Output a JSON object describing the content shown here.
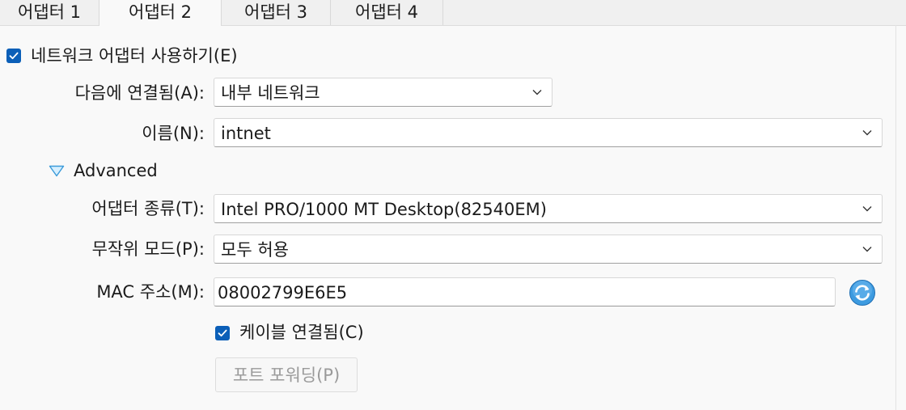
{
  "tabs": [
    {
      "label": "어댑터 1",
      "active": false
    },
    {
      "label": "어댑터 2",
      "active": true
    },
    {
      "label": "어댑터 3",
      "active": false
    },
    {
      "label": "어댑터 4",
      "active": false
    }
  ],
  "enable_adapter": {
    "label": "네트워크 어댑터 사용하기(E)",
    "checked": true
  },
  "attached_to": {
    "label": "다음에 연결됨(A):",
    "value": "내부 네트워크"
  },
  "name": {
    "label": "이름(N):",
    "value": "intnet"
  },
  "advanced": {
    "label": "Advanced",
    "expanded": true
  },
  "adapter_type": {
    "label": "어댑터 종류(T):",
    "value": "Intel PRO/1000 MT Desktop(82540EM)"
  },
  "promiscuous_mode": {
    "label": "무작위 모드(P):",
    "value": "모두 허용"
  },
  "mac_address": {
    "label": "MAC 주소(M):",
    "value": "08002799E6E5"
  },
  "cable_connected": {
    "label": "케이블 연결됨(C)",
    "checked": true
  },
  "port_forwarding": {
    "label": "포트 포워딩(P)",
    "enabled": false
  },
  "colors": {
    "accent": "#0b5fb8",
    "refresh_icon": "#2a8fd8"
  },
  "icons": {
    "checkbox": "check-icon",
    "dropdown": "chevron-down-icon",
    "expander": "triangle-down-icon",
    "refresh": "refresh-mac-icon"
  }
}
